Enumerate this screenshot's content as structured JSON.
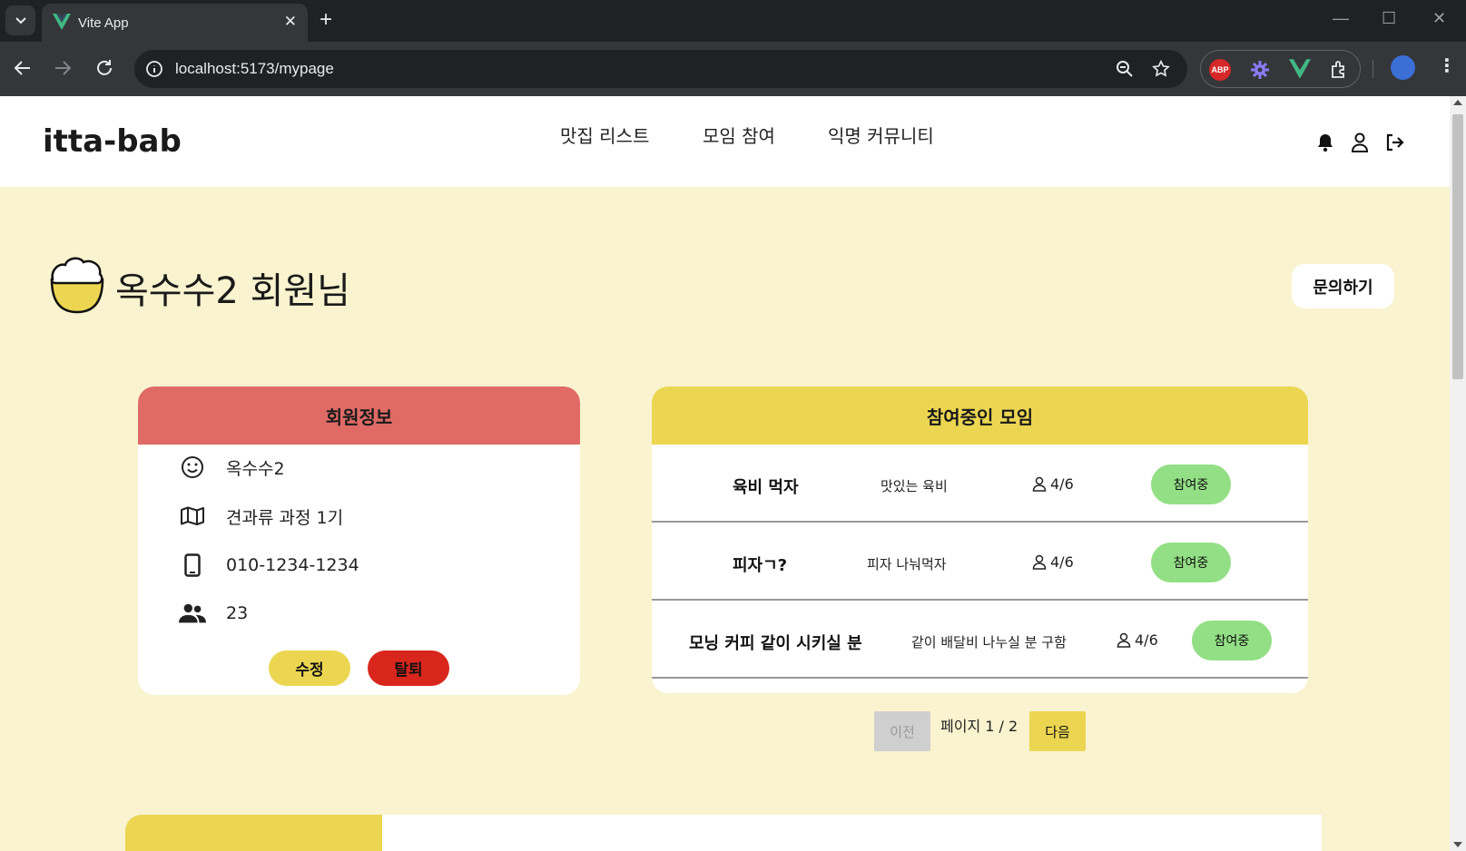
{
  "browser": {
    "tab_title": "Vite App",
    "url": "localhost:5173/mypage",
    "abp_label": "ABP"
  },
  "header": {
    "logo": "itta-bab",
    "nav": [
      "맛집 리스트",
      "모임 참여",
      "익명 커뮤니티"
    ]
  },
  "page": {
    "title": "옥수수2 회원님",
    "inquiry_button": "문의하기"
  },
  "member_info": {
    "heading": "회원정보",
    "name": "옥수수2",
    "course": "견과류 과정 1기",
    "phone": "010-1234-1234",
    "age": "23",
    "edit_button": "수정",
    "withdraw_button": "탈퇴"
  },
  "meetings": {
    "heading": "참여중인 모임",
    "rows": [
      {
        "name": "육비 먹자",
        "desc": "맛있는 육비",
        "count": "4/6",
        "status": "참여중"
      },
      {
        "name": "피자ㄱ?",
        "desc": "피자 나눠먹자",
        "count": "4/6",
        "status": "참여중"
      },
      {
        "name": "모닝 커피 같이 시키실 분",
        "desc": "같이 배달비 나누실 분 구함",
        "count": "4/6",
        "status": "참여중"
      }
    ]
  },
  "pagination": {
    "prev": "이전",
    "info": "페이지 1 / 2",
    "next": "다음"
  },
  "colors": {
    "page_bg": "#f9f3cf",
    "member_header": "#e06b66",
    "meeting_header": "#ecd651",
    "join_button": "#93df85",
    "withdraw_button": "#d9261c"
  }
}
